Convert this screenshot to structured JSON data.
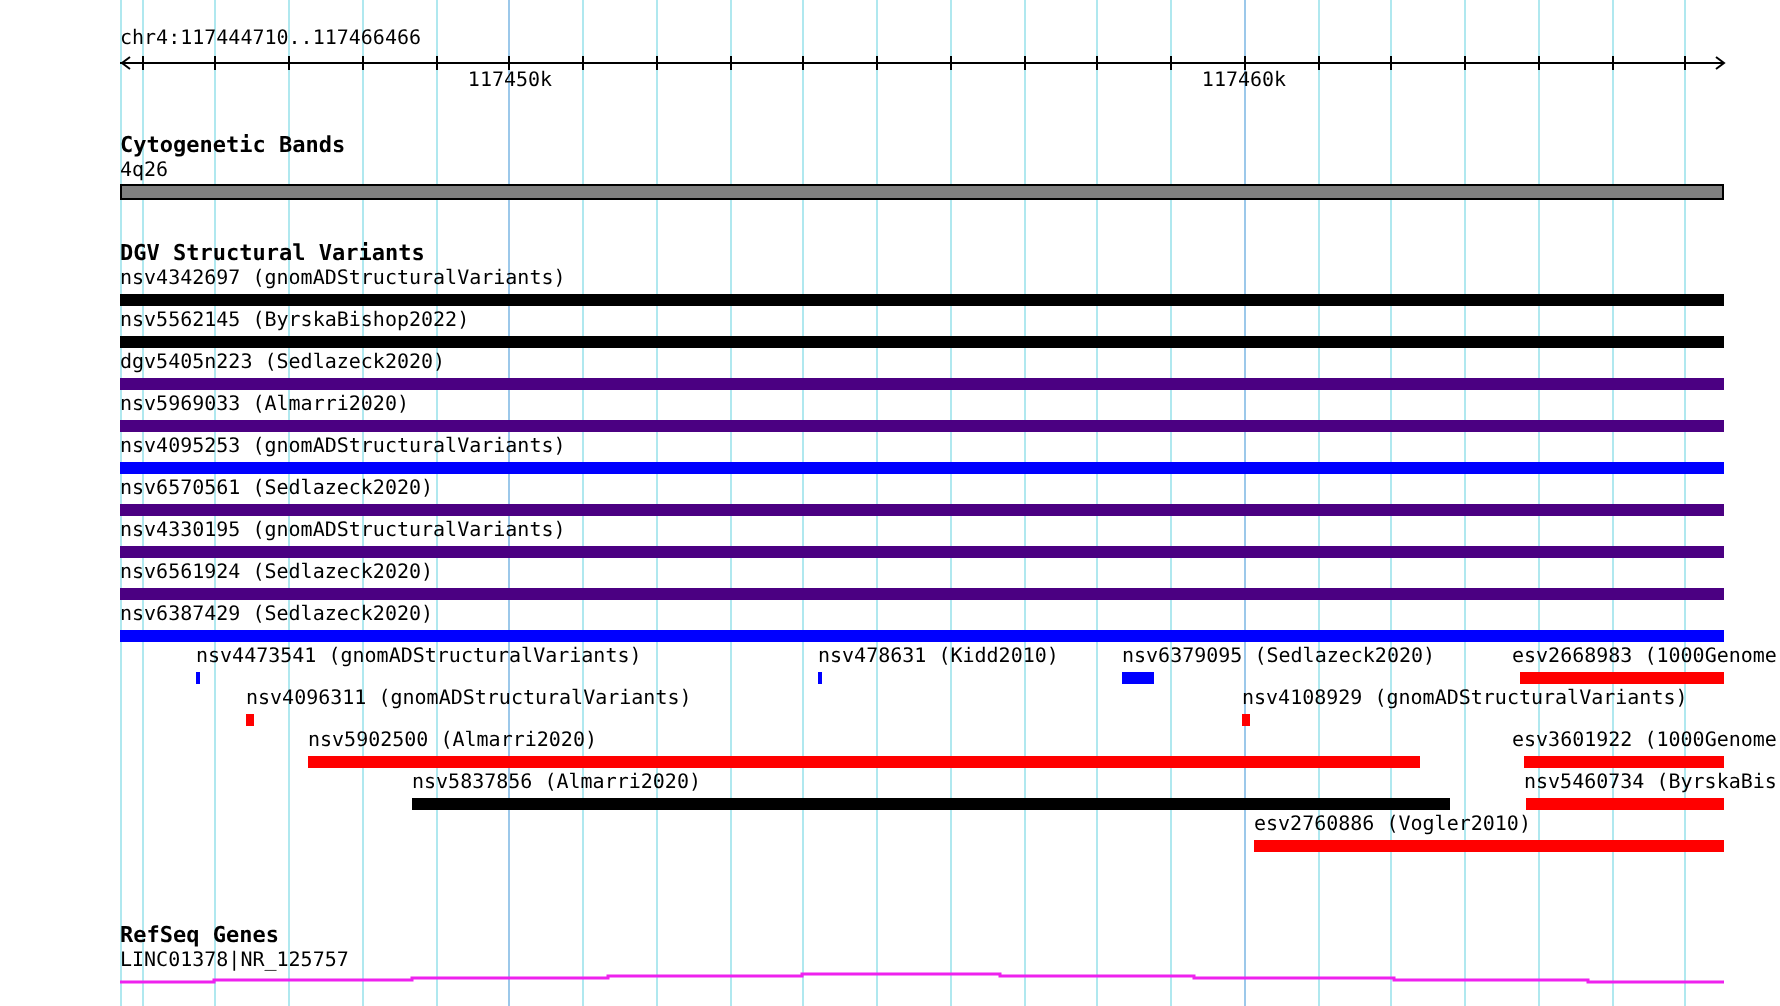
{
  "ruler": {
    "location": "chr4:117444710..117466466",
    "ticks": [
      "117450k",
      "117460k"
    ]
  },
  "tracks": [
    {
      "kind": "cytoband",
      "title": "Cytogenetic Bands",
      "features": [
        {
          "label": "4q26"
        }
      ]
    },
    {
      "kind": "variants",
      "title": "DGV Structural Variants",
      "features": [
        {
          "label": "nsv4342697 (gnomADStructuralVariants)",
          "color": "#000000"
        },
        {
          "label": "nsv5562145 (ByrskaBishop2022)",
          "color": "#000000"
        },
        {
          "label": "dgv5405n223 (Sedlazeck2020)",
          "color": "#4b0082"
        },
        {
          "label": "nsv5969033 (Almarri2020)",
          "color": "#4b0082"
        },
        {
          "label": "nsv4095253 (gnomADStructuralVariants)",
          "color": "#0000ff"
        },
        {
          "label": "nsv6570561 (Sedlazeck2020)",
          "color": "#4b0082"
        },
        {
          "label": "nsv4330195 (gnomADStructuralVariants)",
          "color": "#4b0082"
        },
        {
          "label": "nsv6561924 (Sedlazeck2020)",
          "color": "#4b0082"
        },
        {
          "label": "nsv6387429 (Sedlazeck2020)",
          "color": "#0000ff"
        },
        {
          "label": "nsv4473541 (gnomADStructuralVariants)",
          "color": "#0000ff"
        },
        {
          "label": "nsv478631 (Kidd2010)",
          "color": "#0000ff"
        },
        {
          "label": "nsv6379095 (Sedlazeck2020)",
          "color": "#0000ff"
        },
        {
          "label": "esv2668983 (1000Genome",
          "color": "#ff0000"
        },
        {
          "label": "nsv4096311 (gnomADStructuralVariants)",
          "color": "#ff0000"
        },
        {
          "label": "nsv4108929 (gnomADStructuralVariants)",
          "color": "#ff0000"
        },
        {
          "label": "nsv5902500 (Almarri2020)",
          "color": "#ff0000"
        },
        {
          "label": "esv3601922 (1000Genome",
          "color": "#ff0000"
        },
        {
          "label": "nsv5837856 (Almarri2020)",
          "color": "#000000"
        },
        {
          "label": "nsv5460734 (ByrskaBis",
          "color": "#ff0000"
        },
        {
          "label": "esv2760886 (Vogler2010)",
          "color": "#ff0000"
        }
      ]
    },
    {
      "kind": "genes",
      "title": "RefSeq Genes",
      "features": [
        {
          "label": "LINC01378|NR_125757"
        }
      ]
    }
  ]
}
